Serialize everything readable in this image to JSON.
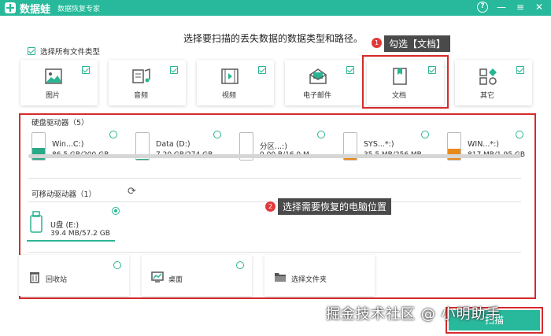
{
  "app": {
    "brand": "数据蛙",
    "subtitle": "数据恢复专家"
  },
  "window_icons": [
    "help-icon",
    "minimize-icon",
    "menu-icon",
    "close-icon"
  ],
  "prompt": "选择要扫描的丢失数据的数据类型和路径。",
  "select_all_label": "选择所有文件类型",
  "file_types": [
    {
      "label": "图片",
      "icon": "image-icon",
      "checked": true
    },
    {
      "label": "音频",
      "icon": "music-icon",
      "checked": true
    },
    {
      "label": "视频",
      "icon": "video-icon",
      "checked": true
    },
    {
      "label": "电子邮件",
      "icon": "email-icon",
      "checked": true
    },
    {
      "label": "文档",
      "icon": "document-icon",
      "checked": true
    },
    {
      "label": "其它",
      "icon": "other-icon",
      "checked": true
    }
  ],
  "annotation_1": {
    "number": "1",
    "text": "勾选【文档】"
  },
  "annotation_2": {
    "number": "2",
    "text": "选择需要恢复的电脑位置"
  },
  "hard_drives": {
    "title": "硬盘驱动器（5）",
    "items": [
      {
        "name": "Win...C:)",
        "size": "86.5 GB/200 GB",
        "fill_percent": 43,
        "fill_color": "#2aa989"
      },
      {
        "name": "Data (D:)",
        "size": "7.20 GB/274 GB",
        "fill_percent": 3,
        "fill_color": "#2aa989"
      },
      {
        "name": "分区...:)",
        "size": "0.00  B/16.0 M",
        "fill_percent": 0,
        "fill_color": "#2aa989"
      },
      {
        "name": "SYS...*:)",
        "size": "35.5 MB/256 MB",
        "fill_percent": 14,
        "fill_color": "#e88a1b"
      },
      {
        "name": "WIN...*:)",
        "size": "817 MB/1.95 GB",
        "fill_percent": 42,
        "fill_color": "#e88a1b"
      }
    ]
  },
  "removable": {
    "title": "可移动驱动器（1）",
    "items": [
      {
        "name": "U盘 (E:)",
        "size": "39.4 MB/57.2 GB",
        "selected": true
      }
    ]
  },
  "locations": [
    {
      "label": "回收站",
      "icon": "recycle-bin-icon"
    },
    {
      "label": "桌面",
      "icon": "desktop-icon"
    },
    {
      "label": "选择文件夹",
      "icon": "folder-icon"
    }
  ],
  "watermark": "掘金技术社区 @ 小明助手",
  "start_button": "扫描"
}
